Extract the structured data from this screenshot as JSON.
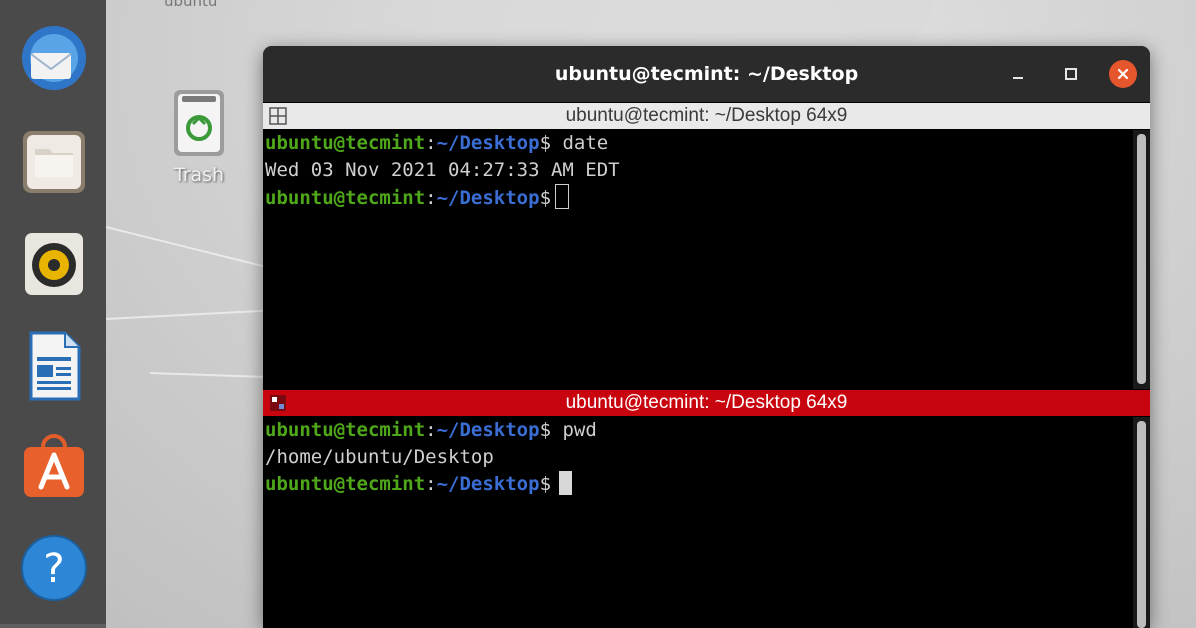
{
  "desktop": {
    "top_label": "ubuntu",
    "trash_label": "Trash"
  },
  "dock": {
    "items": [
      {
        "name": "thunderbird-mail",
        "icon": "mail-icon"
      },
      {
        "name": "files",
        "icon": "folder-icon"
      },
      {
        "name": "rhythmbox",
        "icon": "music-speaker-icon"
      },
      {
        "name": "libreoffice-writer",
        "icon": "document-icon"
      },
      {
        "name": "ubuntu-software",
        "icon": "software-store-icon"
      },
      {
        "name": "help",
        "icon": "help-icon"
      }
    ]
  },
  "window": {
    "title": "ubuntu@tecmint: ~/Desktop"
  },
  "pane1": {
    "header": "ubuntu@tecmint: ~/Desktop 64x9",
    "lines": [
      {
        "user": "ubuntu@tecmint",
        "sep": ":",
        "path": "~/Desktop",
        "cmd": "$ date"
      },
      {
        "output": "Wed 03 Nov 2021 04:27:33 AM EDT"
      },
      {
        "user": "ubuntu@tecmint",
        "sep": ":",
        "path": "~/Desktop",
        "cmd": "$"
      }
    ]
  },
  "pane2": {
    "header": "ubuntu@tecmint: ~/Desktop 64x9",
    "lines": [
      {
        "user": "ubuntu@tecmint",
        "sep": ":",
        "path": "~/Desktop",
        "cmd": "$ pwd"
      },
      {
        "output": "/home/ubuntu/Desktop"
      },
      {
        "user": "ubuntu@tecmint",
        "sep": ":",
        "path": "~/Desktop",
        "cmd": "$"
      }
    ]
  },
  "colors": {
    "active_pane_header": "#c8050f",
    "close_button": "#e6562c",
    "prompt_user": "#4fa81a",
    "prompt_path": "#3b6ed4"
  }
}
